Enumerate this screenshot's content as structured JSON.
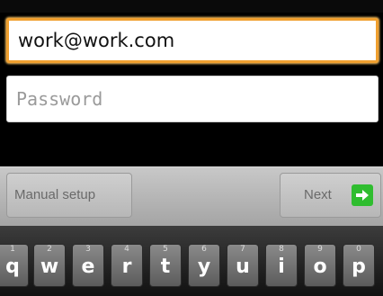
{
  "email": {
    "value": "work@work.com"
  },
  "password": {
    "placeholder": "Password"
  },
  "actions": {
    "manual_setup_label": "Manual setup",
    "next_label": "Next"
  },
  "keyboard": {
    "keys": [
      {
        "letter": "q",
        "number": "1"
      },
      {
        "letter": "w",
        "number": "2"
      },
      {
        "letter": "e",
        "number": "3"
      },
      {
        "letter": "r",
        "number": "4"
      },
      {
        "letter": "t",
        "number": "5"
      },
      {
        "letter": "y",
        "number": "6"
      },
      {
        "letter": "u",
        "number": "7"
      },
      {
        "letter": "i",
        "number": "8"
      },
      {
        "letter": "o",
        "number": "9"
      },
      {
        "letter": "p",
        "number": "0"
      }
    ]
  },
  "colors": {
    "focus_border": "#f0a030",
    "next_icon": "#2fbd2f"
  },
  "icons": {
    "next": "arrow-right-icon"
  }
}
